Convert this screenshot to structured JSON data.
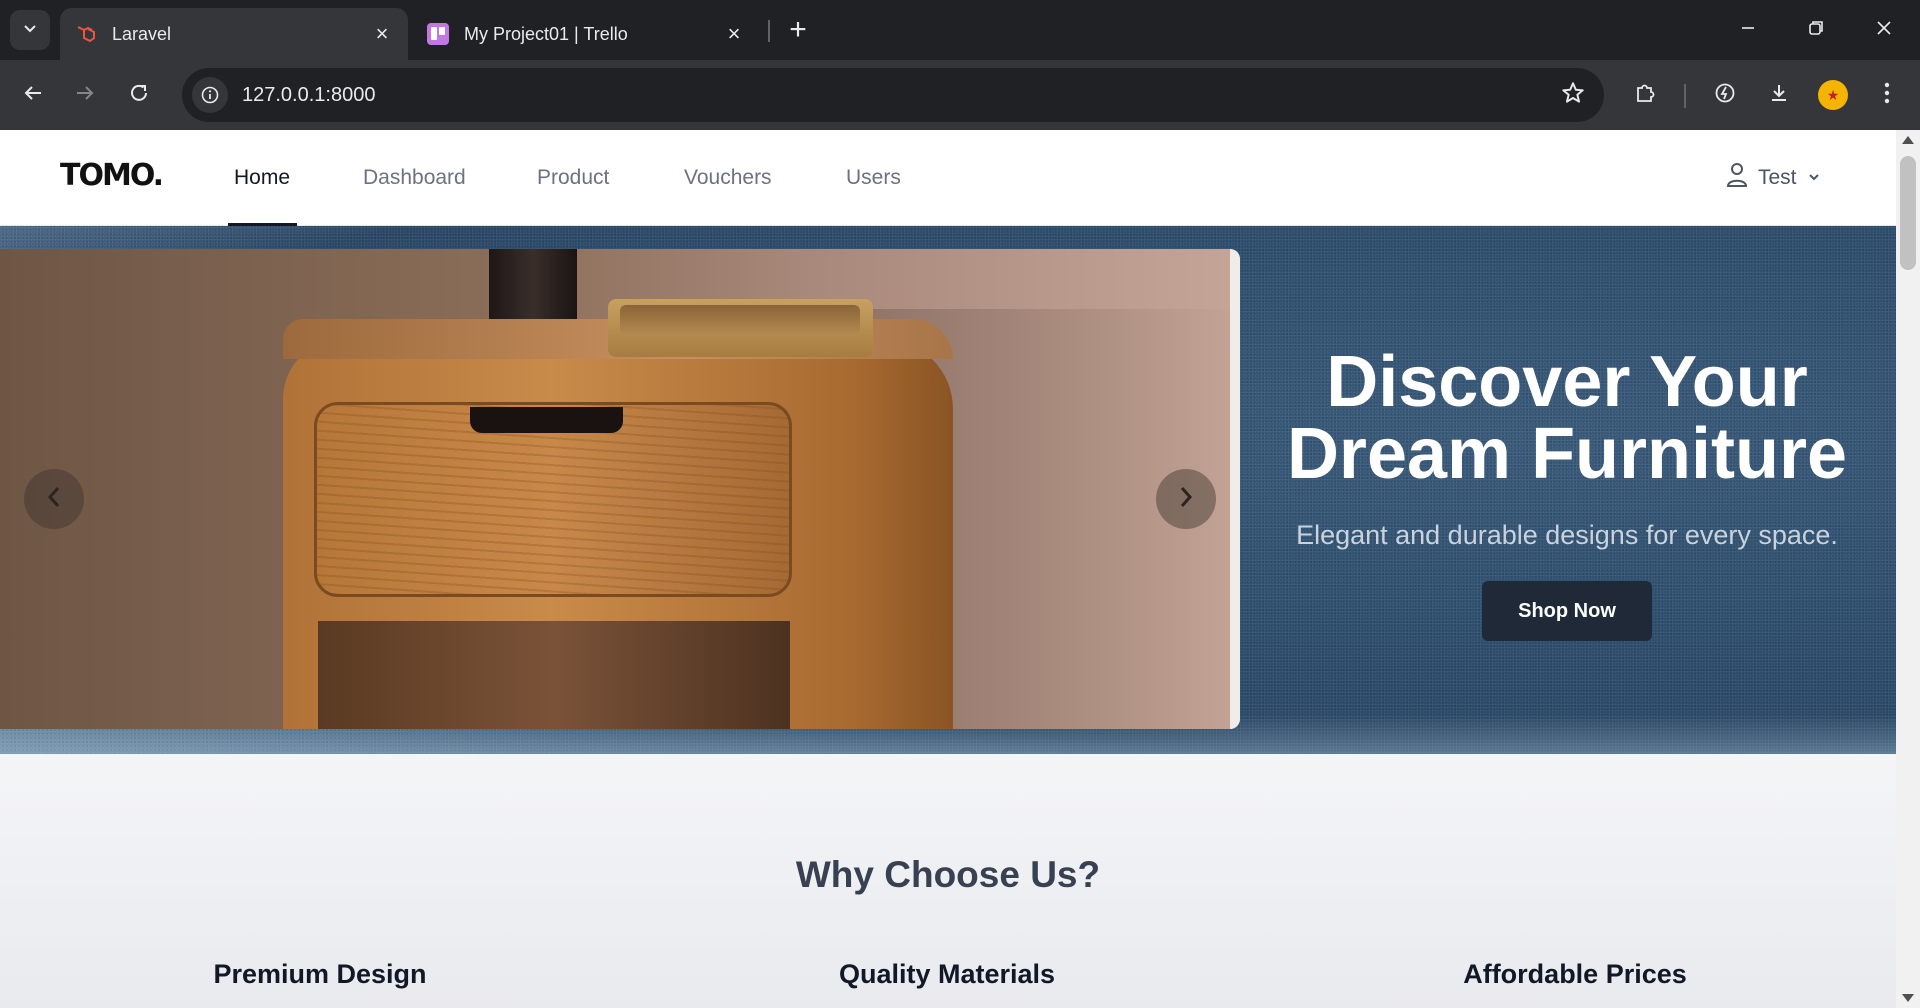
{
  "browser": {
    "tabs": [
      {
        "title": "Laravel",
        "active": true
      },
      {
        "title": "My Project01 | Trello",
        "active": false
      }
    ],
    "url": "127.0.0.1:8000"
  },
  "nav": {
    "logo": "TOMO.",
    "links": [
      "Home",
      "Dashboard",
      "Product",
      "Vouchers",
      "Users"
    ],
    "active": "Home",
    "user": "Test"
  },
  "hero": {
    "title_line1": "Discover Your",
    "title_line2": "Dream Furniture",
    "subtitle": "Elegant and durable designs for every space.",
    "cta": "Shop Now"
  },
  "why": {
    "title": "Why Choose Us?",
    "features": [
      "Premium Design",
      "Quality Materials",
      "Affordable Prices"
    ]
  },
  "colors": {
    "nav_active": "#111827",
    "cta_bg": "#1f2937",
    "trello_favicon": "#c377e0",
    "laravel_favicon": "#f05340"
  }
}
